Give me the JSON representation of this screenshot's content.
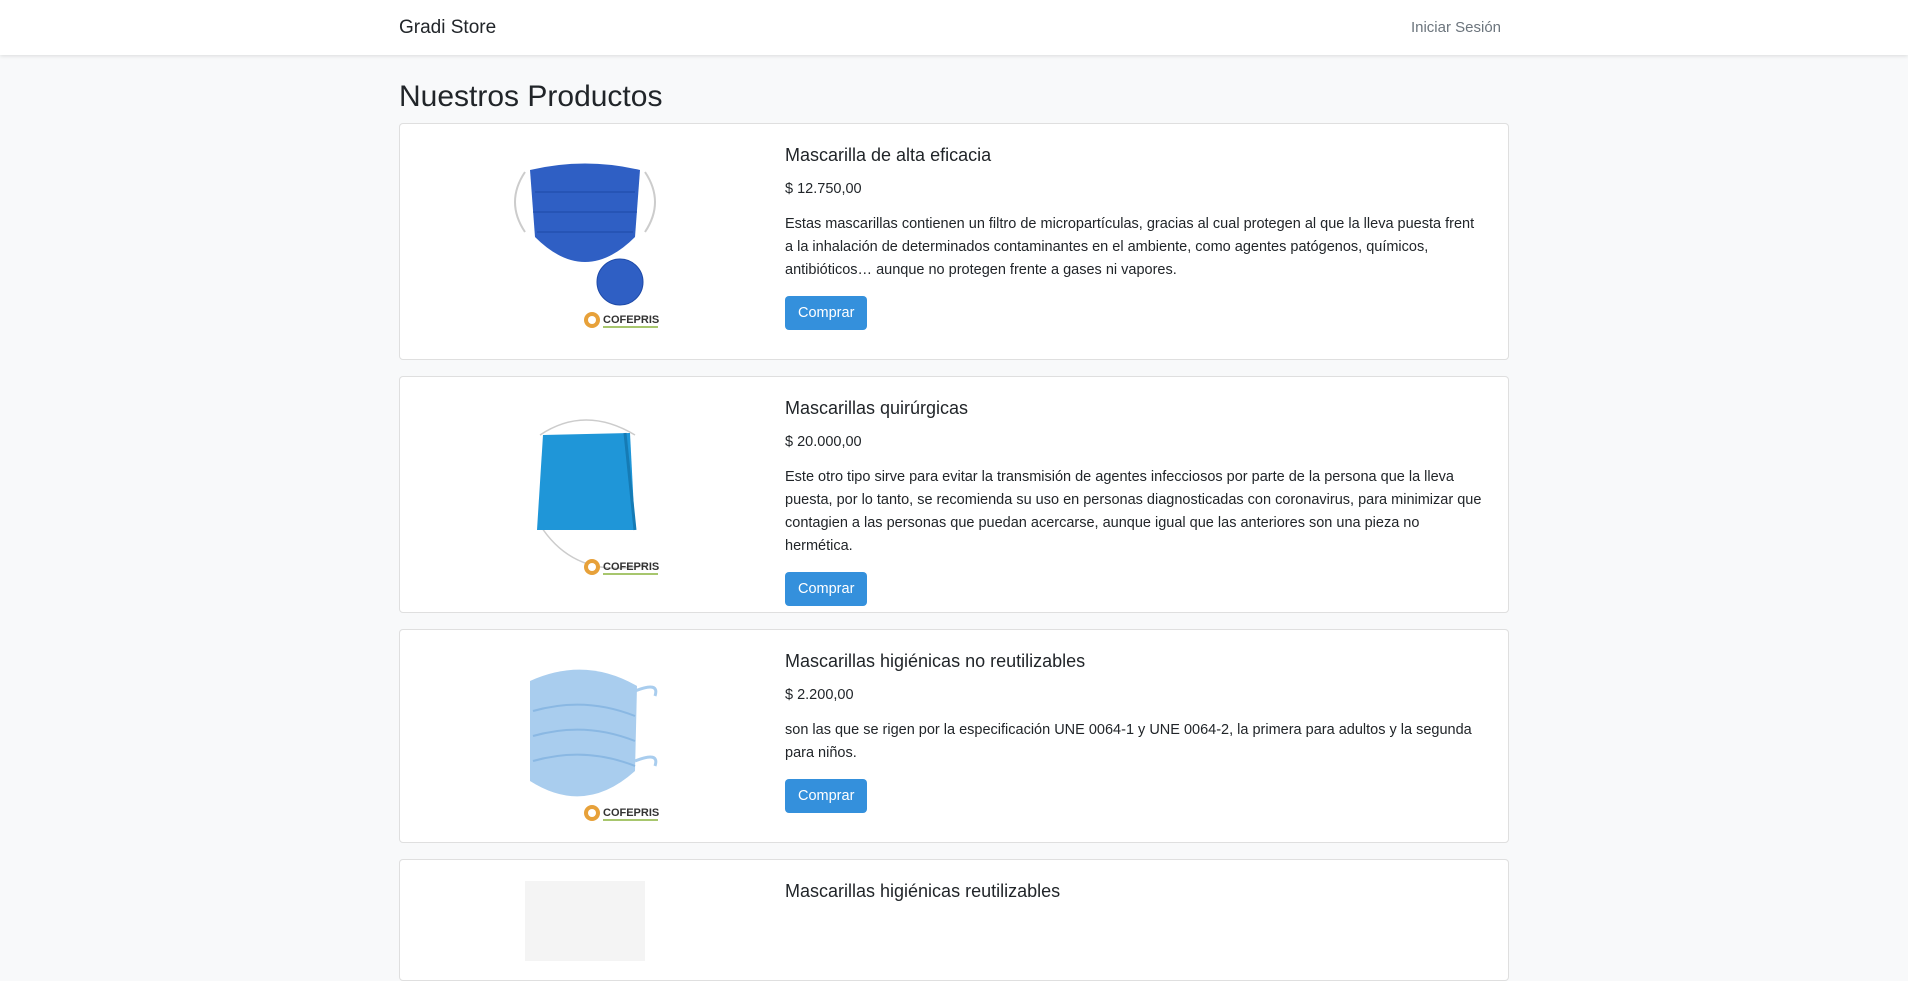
{
  "navbar": {
    "brand": "Gradi Store",
    "login_link": "Iniciar Sesión"
  },
  "page_title": "Nuestros Productos",
  "products": [
    {
      "title": "Mascarilla de alta eficacia",
      "price": "$ 12.750,00",
      "description": "Estas mascarillas contienen un filtro de micropartículas, gracias al cual protegen al que la lleva puesta frent a la inhalación de determinados contaminantes en el ambiente, como agentes patógenos, químicos, antibióticos… aunque no protegen frente a gases ni vapores.",
      "button": "Comprar",
      "image_logo": "COFEPRIS",
      "image_color": "#2f5fc4"
    },
    {
      "title": "Mascarillas quirúrgicas",
      "price": "$ 20.000,00",
      "description": "Este otro tipo sirve para evitar la transmisión de agentes infecciosos por parte de la persona que la lleva puesta, por lo tanto, se recomienda su uso en personas diagnosticadas con coronavirus, para minimizar que contagien a las personas que puedan acercarse, aunque igual que las anteriores son una pieza no hermética.",
      "button": "Comprar",
      "image_logo": "COFEPRIS",
      "image_color": "#1f96d8"
    },
    {
      "title": "Mascarillas higiénicas no reutilizables",
      "price": "$ 2.200,00",
      "description": "son las que se rigen por la especificación UNE 0064-1 y UNE 0064-2, la primera para adultos y la segunda para niños.",
      "button": "Comprar",
      "image_logo": "COFEPRIS",
      "image_color": "#a9cdee"
    },
    {
      "title": "Mascarillas higiénicas reutilizables",
      "price": "",
      "description": "",
      "button": "",
      "image_logo": "",
      "image_color": "#f4f4f4"
    }
  ],
  "colors": {
    "primary_button": "#3490dc",
    "page_background": "#f8f9fa"
  }
}
